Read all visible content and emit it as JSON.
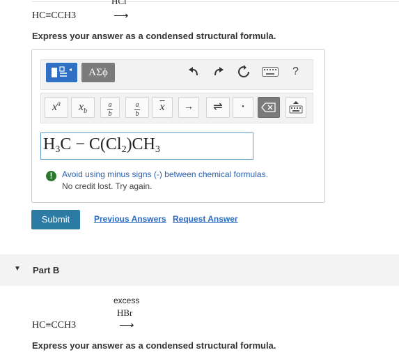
{
  "part_a": {
    "reagent": "HCl",
    "reactant": "HC≡CCH3",
    "arrow": "⟶",
    "prompt": "Express your answer as a condensed structural formula.",
    "answer": {
      "parts": [
        "H",
        "3",
        "C − C(Cl",
        "2",
        ")CH",
        "3"
      ]
    },
    "feedback": {
      "icon": "!",
      "line1": "Avoid using minus signs (-) between chemical formulas.",
      "line2": "No credit lost. Try again."
    },
    "buttons": {
      "submit": "Submit",
      "previous": "Previous Answers",
      "request": "Request Answer"
    }
  },
  "toolbar": {
    "greek": "ΑΣϕ",
    "help": "?",
    "top_icons": [
      "undo-icon",
      "redo-icon",
      "reset-icon",
      "keyboard-icon",
      "help-icon"
    ],
    "tools": {
      "superscript": "x",
      "superscript_sup": "a",
      "subscript": "x",
      "subscript_sub": "b",
      "fraction_top": "a",
      "fraction_bottom": "b",
      "overline": "x",
      "reaction_arrow": "→",
      "equilibrium_arrow": "⇌",
      "dot": "•"
    },
    "colors": {
      "template_button": "#2f6fc4",
      "greek_button": "#7b7b7b"
    }
  },
  "part_b": {
    "label": "Part B",
    "reagent_line1": "excess",
    "reagent_line2": "HBr",
    "reactant": "HC≡CCH3",
    "arrow": "⟶",
    "prompt": "Express your answer as a condensed structural formula."
  }
}
